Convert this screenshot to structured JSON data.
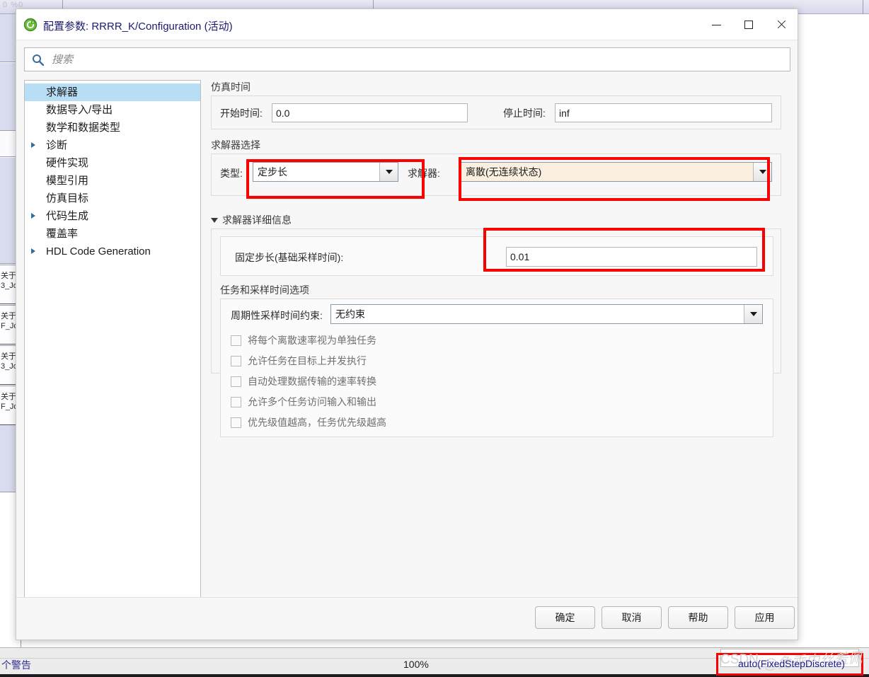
{
  "window": {
    "title": "配置参数: RRRR_K/Configuration (活动)",
    "app_icon": "simulink-icon",
    "minimize_label": "最小化",
    "maximize_label": "最大化",
    "close_label": "关闭"
  },
  "search": {
    "placeholder": "搜索",
    "value": "",
    "icon": "search-icon"
  },
  "sidebar": {
    "items": [
      {
        "label": "求解器",
        "expandable": false,
        "selected": true
      },
      {
        "label": "数据导入/导出",
        "expandable": false,
        "selected": false
      },
      {
        "label": "数学和数据类型",
        "expandable": false,
        "selected": false
      },
      {
        "label": "诊断",
        "expandable": true,
        "selected": false
      },
      {
        "label": "硬件实现",
        "expandable": false,
        "selected": false
      },
      {
        "label": "模型引用",
        "expandable": false,
        "selected": false
      },
      {
        "label": "仿真目标",
        "expandable": false,
        "selected": false
      },
      {
        "label": "代码生成",
        "expandable": true,
        "selected": false
      },
      {
        "label": "覆盖率",
        "expandable": false,
        "selected": false
      },
      {
        "label": "HDL Code Generation",
        "expandable": true,
        "selected": false
      }
    ]
  },
  "main": {
    "sim_time": {
      "section_label": "仿真时间",
      "start_label": "开始时间:",
      "start_value": "0.0",
      "stop_label": "停止时间:",
      "stop_value": "inf"
    },
    "solver_selection": {
      "section_label": "求解器选择",
      "type_label": "类型:",
      "type_value": "定步长",
      "solver_label": "求解器:",
      "solver_value": "离散(无连续状态)"
    },
    "solver_details": {
      "section_label": "求解器详细信息",
      "expanded": true,
      "fixed_step_label": "固定步长(基础采样时间):",
      "fixed_step_value": "0.01"
    },
    "tasking": {
      "section_label": "任务和采样时间选项",
      "constraint_label": "周期性采样时间约束:",
      "constraint_value": "无约束",
      "checkboxes": [
        {
          "label": "将每个离散速率视为单独任务",
          "checked": false
        },
        {
          "label": "允许任务在目标上并发执行",
          "checked": false
        },
        {
          "label": "自动处理数据传输的速率转换",
          "checked": false
        },
        {
          "label": "允许多个任务访问输入和输出",
          "checked": false
        },
        {
          "label": "优先级值越高，任务优先级越高",
          "checked": false
        }
      ]
    }
  },
  "footer": {
    "ok": "确定",
    "cancel": "取消",
    "help": "帮助",
    "apply": "应用"
  },
  "status_bar": {
    "warning_text": "个警告",
    "zoom": "100%"
  },
  "annotations": {
    "highlight_color": "#fb0000",
    "modified_field_color": "#fbefdf",
    "selection_color": "#b8def5",
    "overlay_text": "auto(FixedStepDiscrete)",
    "watermark_latin": "CSDN",
    "watermark_cjk": "@免乖内丝羞佩"
  },
  "background": {
    "list_items": [
      {
        "line1": "关于",
        "line2": "3_Jo"
      },
      {
        "line1": "关于",
        "line2": "F_Jo"
      },
      {
        "line1": "关于",
        "line2": "3_Jo"
      },
      {
        "line1": "关于",
        "line2": "F_Jo"
      }
    ],
    "toolstrip_text": "0 %0"
  }
}
